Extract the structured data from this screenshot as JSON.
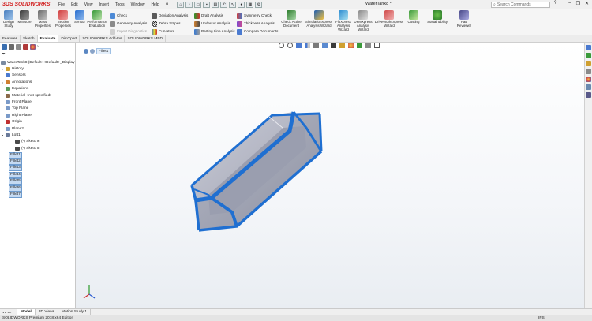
{
  "app": {
    "brand_prefix": "3DS",
    "brand": "SOLIDWORKS",
    "document_title": "WaterTank8 *"
  },
  "menu": [
    "File",
    "Edit",
    "View",
    "Insert",
    "Tools",
    "Window",
    "Help"
  ],
  "search": {
    "placeholder": "Search Commands"
  },
  "toolbar": {
    "design_study": "Design Study",
    "measure": "Measure",
    "mass_properties": "Mass Properties",
    "section_properties": "Section Properties",
    "sensor": "Sensor",
    "performance_evaluation": "Performance Evaluation",
    "check": "Check",
    "geometry_analysis": "Geometry Analysis",
    "import_diagnostics": "Import Diagnostics",
    "deviation_analysis": "Deviation Analysis",
    "zebra_stripes": "Zebra Stripes",
    "curvature": "Curvature",
    "draft_analysis": "Draft Analysis",
    "undercut_analysis": "Undercut Analysis",
    "parting_line_analysis": "Parting Line Analysis",
    "symmetry_check": "Symmetry Check",
    "thickness_analysis": "Thickness Analysis",
    "compare_documents": "Compare Documents",
    "check_active_document": "Check Active Document",
    "simulationxpress": "SimulationXpress Analysis Wizard",
    "floxpress": "FloXpress Analysis Wizard",
    "dfmxpress": "DFMXpress Analysis Wizard",
    "driveworksxpress": "DriveWorksXpress Wizard",
    "costing": "Costing",
    "sustainability": "Sustainability",
    "part_reviewer": "Part Reviewer"
  },
  "cm_tabs": [
    "Features",
    "Sketch",
    "Evaluate",
    "DimXpert",
    "SOLIDWORKS Add-Ins",
    "SOLIDWORKS MBD"
  ],
  "active_cm_tab": "Evaluate",
  "breadcrumb": {
    "item": "Fillet1"
  },
  "tree": {
    "root": "WaterTank8  (Default<<Default>_Display",
    "items": [
      {
        "label": "History",
        "expand": "▸"
      },
      {
        "label": "Sensors",
        "expand": ""
      },
      {
        "label": "Annotations",
        "expand": "▸"
      },
      {
        "label": "Equations",
        "expand": ""
      },
      {
        "label": "Material <not specified>",
        "expand": ""
      },
      {
        "label": "Front Plane",
        "expand": ""
      },
      {
        "label": "Top Plane",
        "expand": ""
      },
      {
        "label": "Right Plane",
        "expand": ""
      },
      {
        "label": "Origin",
        "expand": ""
      },
      {
        "label": "Plane2",
        "expand": ""
      },
      {
        "label": "Loft1",
        "expand": "▾"
      },
      {
        "label": "(-) Sketch6",
        "expand": ""
      },
      {
        "label": "(-) Sketch5",
        "expand": ""
      },
      {
        "label": "Fillet1",
        "expand": ""
      },
      {
        "label": "Fillet2",
        "expand": ""
      },
      {
        "label": "Fillet3",
        "expand": ""
      },
      {
        "label": "Fillet4",
        "expand": ""
      },
      {
        "label": "Fillet5",
        "expand": ""
      },
      {
        "label": "Fillet6",
        "expand": ""
      },
      {
        "label": "Fillet7",
        "expand": ""
      }
    ]
  },
  "bottom_tabs": [
    "Model",
    "3D Views",
    "Motion Study 1"
  ],
  "active_bottom_tab": "Model",
  "status": {
    "text": "SOLIDWORKS Premium 2018 x64 Edition",
    "units": "IPS"
  },
  "colors": {
    "accent_red": "#d21f1f",
    "selection_blue": "#1f6fd1",
    "body_gray": "#a7aab8"
  }
}
